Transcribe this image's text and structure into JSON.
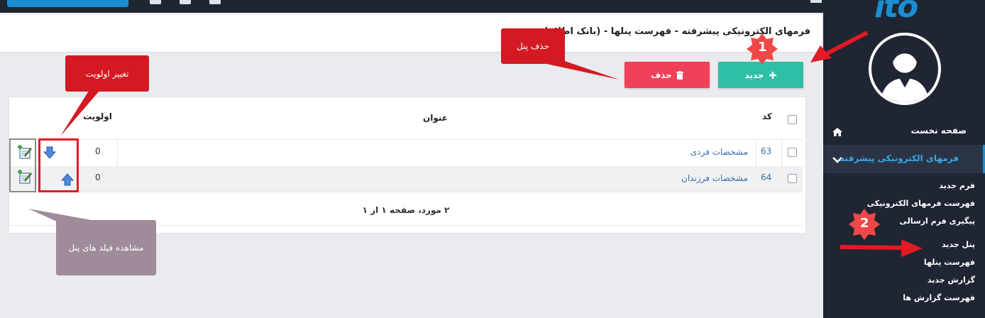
{
  "app": {
    "logo_text": "ito",
    "colors": {
      "accent": "#1a8ed0",
      "success": "#2fbfa5",
      "danger": "#f1405a",
      "sidebar": "#1f2533",
      "callout_red": "#d31a23",
      "callout_mauve": "#9f8b99"
    }
  },
  "sidebar": {
    "home_label": "صفحه نخست",
    "home_icon": "home-icon",
    "forms_label": "فرمهای الکترونیکی پیشرفته",
    "forms_icon": "chevron-down-icon",
    "submenu": [
      "فرم جدید",
      "فهرست فرمهای الکترونیکی",
      "پیگیری فرم ارسالی",
      "پنل جدید",
      "فهرست پنلها",
      "گزارش جدید",
      "فهرست گزارش ها"
    ]
  },
  "header": {
    "title": "فرمهای الکترونیکی پیشرفته - فهرست پنلها - (بانک اطلاعات"
  },
  "toolbar": {
    "new_label": "جدید",
    "new_icon": "plus-icon",
    "delete_label": "حذف",
    "delete_icon": "trash-icon"
  },
  "grid": {
    "columns": {
      "code": "کد",
      "title": "عنوان",
      "priority": "اولویت"
    },
    "rows": [
      {
        "code": "63",
        "title": "مشخصات فردی",
        "priority": "0"
      },
      {
        "code": "64",
        "title": "مشخصات فرزندان",
        "priority": "0"
      }
    ],
    "pager": "۲ مورد، صفحه ۱ از ۱"
  },
  "annotations": {
    "delete_panel": "حذف پنل",
    "change_priority": "تغییر اولویت",
    "view_fields": "مشاهده فیلد های پنل",
    "badge1": "1",
    "badge2": "2"
  }
}
